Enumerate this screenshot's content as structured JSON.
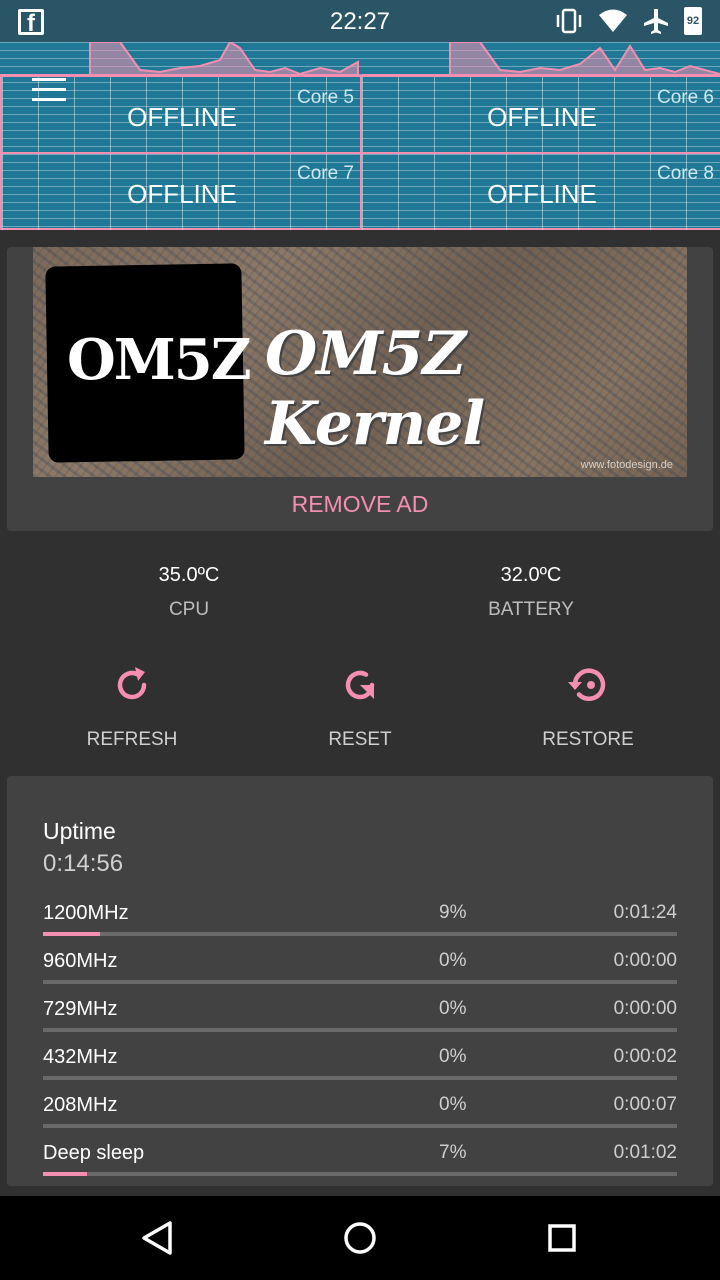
{
  "status_bar": {
    "time": "22:27",
    "battery_level": "92",
    "app_icon": "facebook-icon",
    "icons": [
      "vibrate-icon",
      "wifi-icon",
      "airplane-icon",
      "battery-icon"
    ]
  },
  "cores": [
    {
      "label": "Core 5",
      "status": "OFFLINE"
    },
    {
      "label": "Core 6",
      "status": "OFFLINE"
    },
    {
      "label": "Core 7",
      "status": "OFFLINE"
    },
    {
      "label": "Core 8",
      "status": "OFFLINE"
    }
  ],
  "ad": {
    "logo_text": "OM5Z",
    "banner_text": "OM5Z Kernel",
    "fine_print": "www.fotodesign.de",
    "remove_label": "REMOVE AD"
  },
  "temps": {
    "cpu": {
      "value": "35.0ºC",
      "label": "CPU"
    },
    "battery": {
      "value": "32.0ºC",
      "label": "BATTERY"
    }
  },
  "actions": {
    "refresh": "REFRESH",
    "reset": "RESET",
    "restore": "RESTORE"
  },
  "stats": {
    "uptime_label": "Uptime",
    "uptime_value": "0:14:56",
    "rows": [
      {
        "name": "1200MHz",
        "percent": "9%",
        "time": "0:01:24",
        "fraction": 0.09
      },
      {
        "name": "960MHz",
        "percent": "0%",
        "time": "0:00:00",
        "fraction": 0
      },
      {
        "name": "729MHz",
        "percent": "0%",
        "time": "0:00:00",
        "fraction": 0
      },
      {
        "name": "432MHz",
        "percent": "0%",
        "time": "0:00:02",
        "fraction": 0
      },
      {
        "name": "208MHz",
        "percent": "0%",
        "time": "0:00:07",
        "fraction": 0
      },
      {
        "name": "Deep sleep",
        "percent": "7%",
        "time": "0:01:02",
        "fraction": 0.07
      }
    ]
  },
  "colors": {
    "accent": "#f48fb1",
    "status_bar": "#2a5566",
    "graph_bg": "#1e7896",
    "card_bg": "#424242",
    "page_bg": "#303030"
  },
  "nav": [
    "back-icon",
    "home-icon",
    "recents-icon"
  ]
}
